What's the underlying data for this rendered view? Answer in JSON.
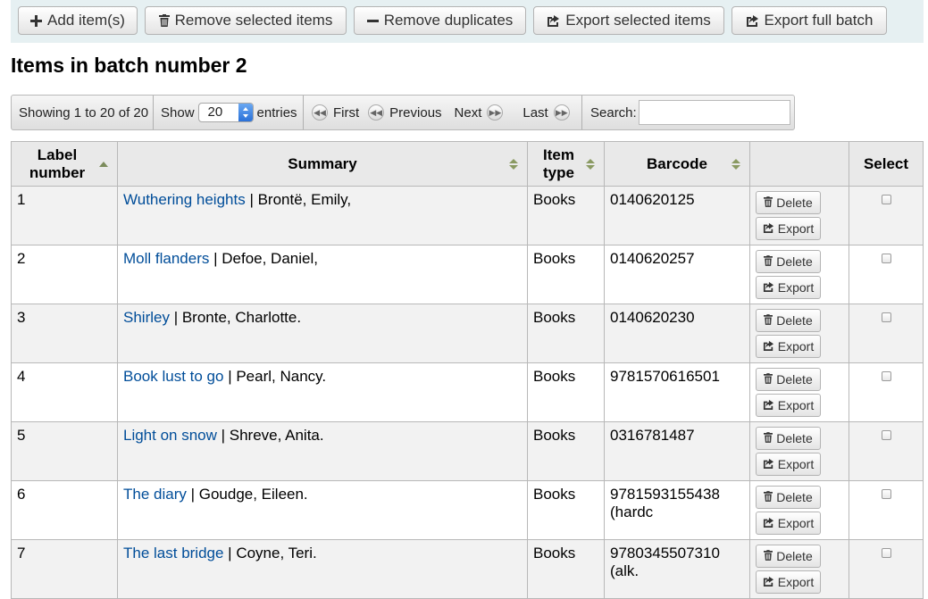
{
  "toolbar": {
    "add_label": "Add item(s)",
    "remove_selected_label": "Remove selected items",
    "remove_duplicates_label": "Remove duplicates",
    "export_selected_label": "Export selected items",
    "export_full_label": "Export full batch"
  },
  "page_title": "Items in batch number 2",
  "datatable": {
    "info": "Showing 1 to 20 of 20",
    "show_label": "Show",
    "page_size": "20",
    "entries_label": "entries",
    "first": "First",
    "previous": "Previous",
    "next": "Next",
    "last": "Last",
    "search_label": "Search:",
    "search_value": ""
  },
  "columns": {
    "label_number": "Label number",
    "summary": "Summary",
    "item_type": "Item type",
    "barcode": "Barcode",
    "actions": "",
    "select": "Select"
  },
  "row_actions": {
    "delete": "Delete",
    "export": "Export"
  },
  "rows": [
    {
      "label": "1",
      "title": "Wuthering heights",
      "author": " | Brontë, Emily,",
      "type": "Books",
      "barcode": "0140620125"
    },
    {
      "label": "2",
      "title": "Moll flanders",
      "author": " | Defoe, Daniel,",
      "type": "Books",
      "barcode": "0140620257"
    },
    {
      "label": "3",
      "title": "Shirley",
      "author": " | Bronte, Charlotte.",
      "type": "Books",
      "barcode": "0140620230"
    },
    {
      "label": "4",
      "title": "Book lust to go",
      "author": " | Pearl, Nancy.",
      "type": "Books",
      "barcode": "9781570616501"
    },
    {
      "label": "5",
      "title": "Light on snow",
      "author": " | Shreve, Anita.",
      "type": "Books",
      "barcode": "0316781487"
    },
    {
      "label": "6",
      "title": "The diary",
      "author": " | Goudge, Eileen.",
      "type": "Books",
      "barcode": "9781593155438 (hardc"
    },
    {
      "label": "7",
      "title": "The last bridge",
      "author": " | Coyne, Teri.",
      "type": "Books",
      "barcode": "9780345507310 (alk."
    }
  ]
}
